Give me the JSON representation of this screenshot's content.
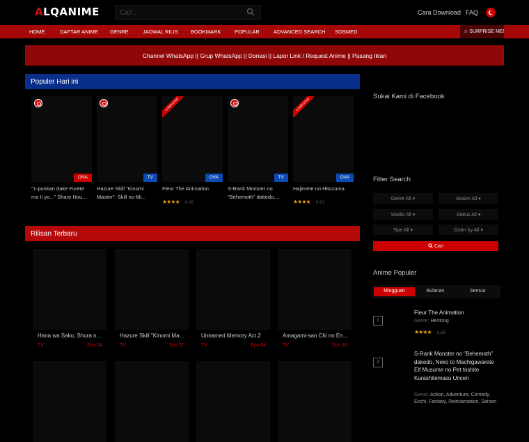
{
  "header": {
    "logo_text": "ALQANIME",
    "search_placeholder": "Cari...",
    "links": [
      "Cara Download",
      "FAQ"
    ]
  },
  "nav": {
    "items": [
      "HOME",
      "DAFTAR ANIME",
      "GENRE",
      "JADWAL RILIS",
      "BOOKMARK",
      "POPULAR",
      "ADVANCED SEARCH",
      "SOSMED"
    ],
    "surprise_label": "SURPRISE ME!"
  },
  "banner": {
    "text": "Channel WhatsApp || Grup WhatsApp || Donasi || Lapor Link / Request Anime || Pasang Iklan"
  },
  "populer": {
    "heading": "Populer Hari ini",
    "cards": [
      {
        "title": "\"1-punkan dake Furete mo Ii yo...\" Share Hou...",
        "type": "ONA",
        "hot": true,
        "completed": false
      },
      {
        "title": "Hazure Skill \"Kinomi Master\": Skill no Mi...",
        "type": "TV",
        "hot": true,
        "completed": false
      },
      {
        "title": "Fleur The Animation",
        "type": "OVA",
        "hot": false,
        "completed": true,
        "stars": "★★★★",
        "score": "6.86"
      },
      {
        "title": "S-Rank Monster no \"Behemoth\" dakedo,...",
        "type": "TV",
        "hot": true,
        "completed": false
      },
      {
        "title": "Hajimete no Hitozuma",
        "type": "OVA",
        "hot": false,
        "completed": true,
        "stars": "★★★★",
        "score": "6.81"
      }
    ],
    "completed_label": "COMPLETED"
  },
  "rilisan": {
    "heading": "Rilisan Terbaru",
    "cards": [
      {
        "title": "Hana wa Saku, Shura no Hana",
        "type": "TV",
        "eps": "Eps 04"
      },
      {
        "title": "Hazure Skill \"Kinomi Master\"",
        "type": "TV",
        "eps": "Eps 05"
      },
      {
        "title": "Unnamed Memory Act.2",
        "type": "TV",
        "eps": "Eps 04"
      },
      {
        "title": "Amagami-san Chi no Enmusubi",
        "type": "TV",
        "eps": "Eps 16"
      }
    ]
  },
  "sidebar": {
    "facebook_heading": "Sukai Kami di Facebook",
    "filter_heading": "Filter Search",
    "filters": [
      "Genre All",
      "Musim All",
      "Studio All",
      "Status All",
      "Tipe All",
      "Order by All"
    ],
    "search_button": "Cari",
    "popular_heading": "Anime Populer",
    "tabs": [
      "Mingguan",
      "Bulanan",
      "Semua"
    ],
    "active_tab": "Mingguan",
    "genre_label": "Genre:",
    "items": [
      {
        "rank": "1",
        "title": "Fleur The Animation",
        "genres": "Hentong",
        "stars": "★★★★",
        "score": "6.86"
      },
      {
        "rank": "2",
        "title": "S-Rank Monster no \"Behemoth\" dakedo, Neko to Machigawarete Elf Musume no Pet toshite Kurashitemasu Uncen",
        "genres": "Action, Adventure, Comedy, Ecchi, Fantasy, Reincarnation, Seinen"
      }
    ]
  },
  "colors": {
    "accent": "#c00000",
    "nav_bg": "#a60808",
    "blue_header": "#0a2f8a",
    "star": "#e8a10a"
  }
}
